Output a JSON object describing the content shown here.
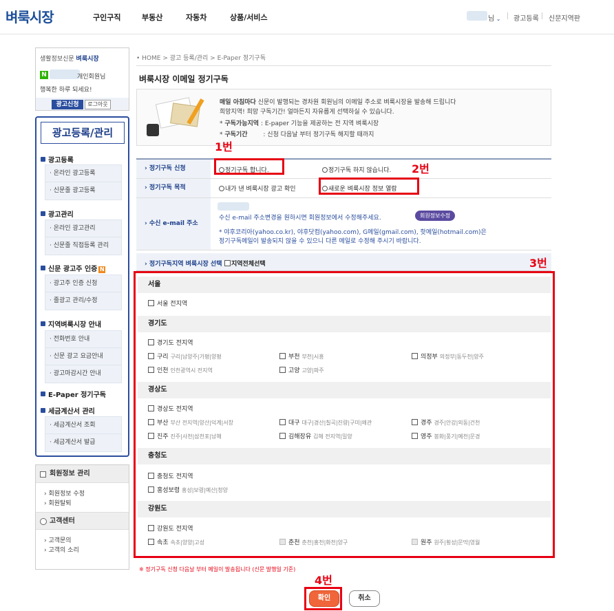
{
  "header": {
    "logo": "벼룩시장",
    "nav": [
      "구인구직",
      "부동산",
      "자동차",
      "상품/서비스"
    ],
    "user_suffix": "님",
    "links": [
      "광고등록",
      "신문지역판"
    ]
  },
  "sidebar": {
    "brand_prefix": "생활정보신문 ",
    "brand": "벼룩시장",
    "badge": "N",
    "member_suffix": "개인회원님",
    "greeting": "행복한 하루 되세요!",
    "ad_button": "광고신청",
    "logout_button": "로그아웃",
    "menu_title": "광고등록/관리",
    "sections": [
      {
        "label": "광고등록",
        "items": [
          "온라인 광고등록",
          "신문줄 광고등록"
        ]
      },
      {
        "label": "광고관리",
        "items": [
          "온라인 광고관리",
          "신문줄 직접등록 관리"
        ]
      },
      {
        "label": "신문 광고주 인증",
        "new": "N",
        "items": [
          "광고주 인증 신청",
          "줄광고 관리/수정"
        ]
      },
      {
        "label": "지역벼룩시장 안내",
        "items": [
          "전화번호 안내",
          "신문 광고 요금안내",
          "광고마감시간 안내"
        ]
      },
      {
        "label": "E-Paper 정기구독",
        "items": []
      },
      {
        "label": "세금계산서 관리",
        "items": [
          "세금계산서 조회",
          "세금계산서 발급"
        ]
      }
    ],
    "member_title": "회원정보 관리",
    "member_items": [
      "회원정보 수정",
      "회원탈퇴"
    ],
    "cs_title": "고객센터",
    "cs_items": [
      "고객문의",
      "고객의 소리"
    ]
  },
  "main": {
    "breadcrumb": "• HOME > 광고 등록/관리 > E-Paper 정기구독",
    "title": "벼룩시장 이메일 정기구독",
    "intro_bold": "매일 아침마다",
    "intro_line1": " 신문이 발행되는 경차원 회원님의 이메일 주소로 벼룩시장을 발송해 드립니다",
    "intro_line2": "희망지역! 희망 구독기간! 얼마든지 자유롭게 선택하실 수 있습니다.",
    "region_label": "구독가능지역",
    "region_text": ": E-paper 기능을 제공하는 전 지역 벼룩시장",
    "period_label": "구독기간",
    "period_text": ": 신청 다음날 부터 정기구독 해지할 때까지",
    "row1_label": "정기구독 신청",
    "row1_opt1": "정기구독 합니다.",
    "row1_opt2": "정기구독 하지 않습니다.",
    "row2_label": "정기구독 목적",
    "row2_opt1": "내가 낸 벼룩시장 광고 확인",
    "row2_opt2": "새로운 벼룩시장 정보 열람",
    "row3_label": "수신 e-mail 주소",
    "email_note": "수신 e-mail 주소변경을 원하시면 회원정보에서 수정해주세요.",
    "edit_button": "회원정보수정",
    "email_warn1": "* 야후코리아(yahoo.co.kr), 야후닷컴(yahoo.com), G메일(gmail.com), 핫메일(hotmail.com)은",
    "email_warn2": "정기구독메일이 발송되지 않을 수 있으니 다른 메일로 수정해 주시기 바랍니다.",
    "row4_label": "정기구독지역 벼룩시장 선택",
    "all_regions": "지역전체선택",
    "footnote": "※ 정기구독 신청 다음날 부터 메일이 발송됩니다 (신문 발행일 기준)",
    "confirm_button": "확인",
    "cancel_button": "취소"
  },
  "annotations": [
    "1번",
    "2번",
    "3번",
    "4번"
  ],
  "regions": [
    {
      "name": "서울",
      "items": [
        {
          "label": "서울 전지역",
          "sub": ""
        }
      ]
    },
    {
      "name": "경기도",
      "items": [
        {
          "label": "경기도 전지역",
          "sub": ""
        },
        {
          "label": "구리",
          "sub": "구리|남양주|가평|양평"
        },
        {
          "label": "부천",
          "sub": "부천|시흥"
        },
        {
          "label": "의정부",
          "sub": "의정부|동두천|양주"
        },
        {
          "label": "인천",
          "sub": "인천광역시 전지역"
        },
        {
          "label": "고양",
          "sub": "고양|파주"
        }
      ]
    },
    {
      "name": "경상도",
      "items": [
        {
          "label": "경상도 전지역",
          "sub": ""
        },
        {
          "label": "부산",
          "sub": "부산 전지역|양산|덕계|서창"
        },
        {
          "label": "대구",
          "sub": "대구|경산|칠곡|진량|구미|왜관"
        },
        {
          "label": "경주",
          "sub": "경주|안강|외동|건천"
        },
        {
          "label": "진주",
          "sub": "진주|사천|삼천포|남해"
        },
        {
          "label": "김해장유",
          "sub": "김해 전지역|밀양"
        },
        {
          "label": "영주",
          "sub": "봉화|풍기|예천|문경"
        }
      ]
    },
    {
      "name": "충청도",
      "items": [
        {
          "label": "충청도 전지역",
          "sub": ""
        },
        {
          "label": "홍성보령",
          "sub": "홍성|보령|예산|청양"
        }
      ]
    },
    {
      "name": "강원도",
      "items": [
        {
          "label": "강원도 전지역",
          "sub": ""
        },
        {
          "label": "속초",
          "sub": "속초|양양|고성"
        },
        {
          "label": "춘천",
          "sub": "춘천|홍천|화천|양구"
        },
        {
          "label": "원주",
          "sub": "원주|횡성|문막|영월"
        }
      ]
    }
  ]
}
